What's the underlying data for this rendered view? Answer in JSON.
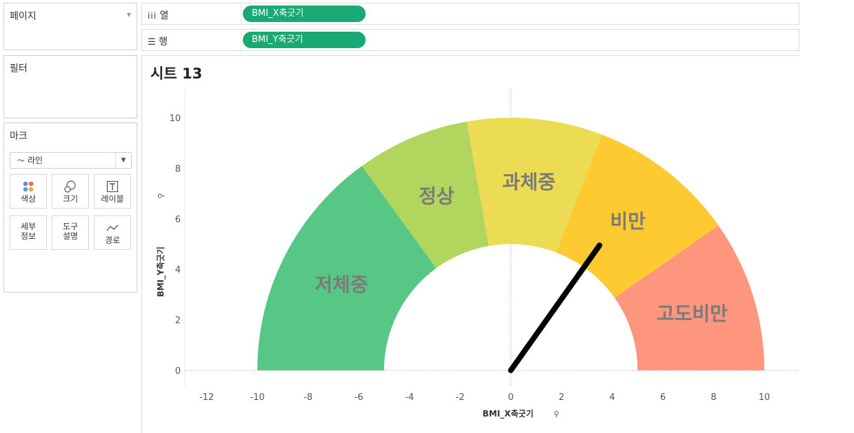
{
  "sidebar": {
    "pages_title": "페이지",
    "filters_title": "필터",
    "marks_title": "마크",
    "mark_type": "라인",
    "mark_buttons": {
      "color": "색상",
      "size": "크기",
      "label": "레이블",
      "detail_1": "세부",
      "detail_2": "정보",
      "tooltip_1": "도구",
      "tooltip_2": "설명",
      "path": "경로"
    }
  },
  "shelves": {
    "columns_label": "열",
    "columns_pill": "BMI_X축긋기",
    "rows_label": "행",
    "rows_pill": "BMI_Y축긋기"
  },
  "sheet": {
    "title": "시트 13"
  },
  "colors": {
    "underweight": "#57c785",
    "normal": "#b0d65e",
    "overweight": "#ebdc53",
    "obese": "#fdca32",
    "severe_obese": "#fe967e",
    "needle": "#000000",
    "pill": "#19a974"
  },
  "chart_data": {
    "type": "gauge",
    "xlabel": "BMI_X축긋기",
    "ylabel": "BMI_Y축긋기",
    "xlim": [
      -13,
      11.5
    ],
    "ylim": [
      -1,
      11
    ],
    "x_ticks": [
      -12,
      -10,
      -8,
      -6,
      -4,
      -2,
      0,
      2,
      4,
      6,
      8,
      10
    ],
    "y_ticks": [
      0,
      2,
      4,
      6,
      8,
      10
    ],
    "inner_radius": 5,
    "outer_radius": 10,
    "segments": [
      {
        "label": "저체중",
        "start_deg": 180,
        "end_deg": 126,
        "color_key": "underweight"
      },
      {
        "label": "정상",
        "start_deg": 126,
        "end_deg": 100,
        "color_key": "normal"
      },
      {
        "label": "과체중",
        "start_deg": 100,
        "end_deg": 69,
        "color_key": "overweight"
      },
      {
        "label": "비만",
        "start_deg": 69,
        "end_deg": 35,
        "color_key": "obese"
      },
      {
        "label": "고도비만",
        "start_deg": 35,
        "end_deg": 0,
        "color_key": "severe_obese"
      }
    ],
    "needle": {
      "x": [
        0,
        3.5
      ],
      "y": [
        0,
        4.95
      ]
    }
  }
}
